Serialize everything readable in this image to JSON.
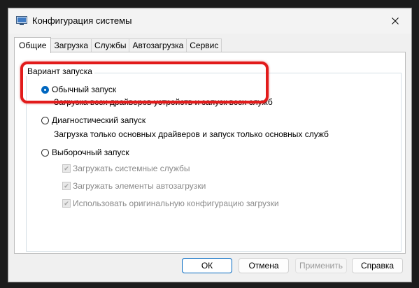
{
  "window": {
    "title": "Конфигурация системы"
  },
  "tabs": [
    {
      "label": "Общие",
      "active": true
    },
    {
      "label": "Загрузка",
      "active": false
    },
    {
      "label": "Службы",
      "active": false
    },
    {
      "label": "Автозагрузка",
      "active": false
    },
    {
      "label": "Сервис",
      "active": false
    }
  ],
  "general": {
    "group_title": "Вариант запуска",
    "options": [
      {
        "label": "Обычный запуск",
        "description": "Загрузка всех драйверов устройств и запуск всех служб",
        "selected": true
      },
      {
        "label": "Диагностический запуск",
        "description": "Загрузка только основных драйверов и запуск только основных служб",
        "selected": false
      },
      {
        "label": "Выборочный запуск",
        "selected": false
      }
    ],
    "selective_checks": [
      {
        "label": "Загружать системные службы",
        "checked": true,
        "enabled": false
      },
      {
        "label": "Загружать элементы автозагрузки",
        "checked": true,
        "enabled": false
      },
      {
        "label": "Использовать оригинальную конфигурацию загрузки",
        "checked": true,
        "enabled": false
      }
    ]
  },
  "buttons": {
    "ok": "ОК",
    "cancel": "Отмена",
    "apply": "Применить",
    "help": "Справка"
  },
  "colors": {
    "accent": "#0067c0",
    "highlight": "#e21b1b"
  }
}
